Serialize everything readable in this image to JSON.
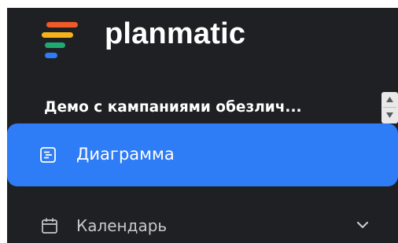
{
  "brand": {
    "name": "planmatic",
    "logo_colors": [
      "#f05a28",
      "#f6b21b",
      "#1fa971",
      "#2d7cf6"
    ]
  },
  "project": {
    "name": "Демо с кампаниями обезлич..."
  },
  "nav": {
    "active": {
      "label": "Диаграмма",
      "icon": "gantt-chart-icon"
    },
    "items": [
      {
        "label": "Календарь",
        "icon": "calendar-icon",
        "expand_icon": "chevron-down-icon"
      }
    ]
  },
  "colors": {
    "sidebar_bg": "#1f2023",
    "accent": "#2e7cf6",
    "text": "#ffffff",
    "muted_text": "#c7c8cc"
  }
}
